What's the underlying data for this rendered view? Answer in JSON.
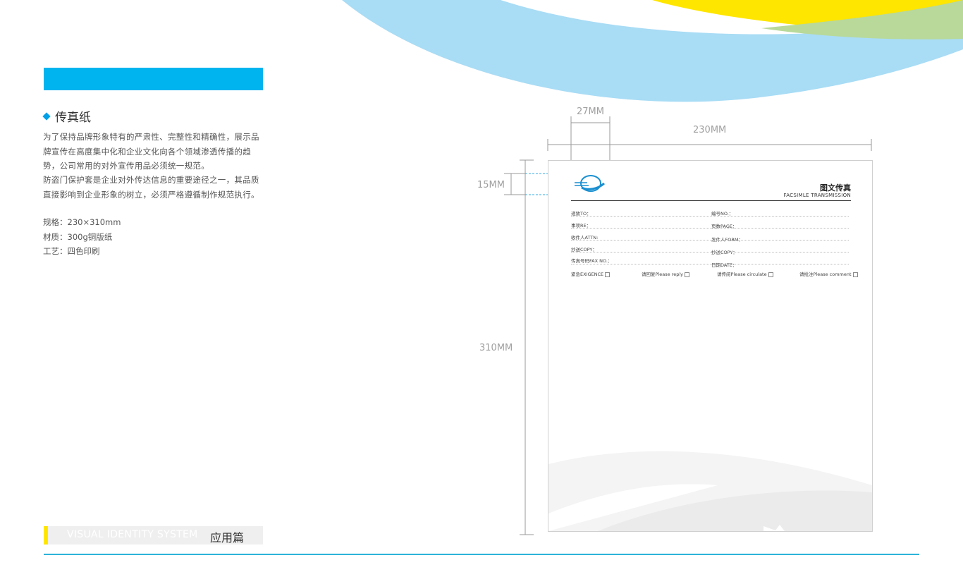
{
  "section": {
    "title": "传真纸",
    "paragraph1": "为了保持品牌形象特有的严肃性、完整性和精确性，展示品牌宣传在高度集中化和企业文化向各个领域渗透传播的趋势，公司常用的对外宣传用品必须统一规范。",
    "paragraph2": "防盗门保护套是企业对外传达信息的重要途径之一，其品质直接影响到企业形象的树立，必须严格遵循制作规范执行。",
    "spec_size": "规格：230×310mm",
    "spec_material": "材质：300g铜版纸",
    "spec_process": "工艺：四色印刷"
  },
  "dimensions": {
    "logo_width": "27MM",
    "paper_width": "230MM",
    "logo_height": "15MM",
    "paper_height": "310MM"
  },
  "fax": {
    "title": "图文传真",
    "subtitle": "FACSIMLE TRANSMISSION",
    "left_fields": [
      "递致TO：",
      "事项RE：",
      "收件人ATTN:",
      "抄送COPY：",
      "传真号码FAX NO.："
    ],
    "right_fields": [
      "编号NO.：",
      "页数PAGE：",
      "发件人FORM：",
      "抄送COPY：",
      "日期DATE："
    ],
    "checkboxes": [
      "紧急EXIGENCE",
      "请回复Please reply",
      "请传阅Please circulate",
      "请批注Please comment"
    ]
  },
  "footer": {
    "english": "VISUAL IDENTITY SYSTEM",
    "chinese": "应用篇"
  },
  "colors": {
    "accent_blue": "#00b4ef",
    "light_blue": "#a9dcf5",
    "yellow": "#ffe600",
    "green": "#b8d99a",
    "footer_line": "#2cb3d8"
  }
}
